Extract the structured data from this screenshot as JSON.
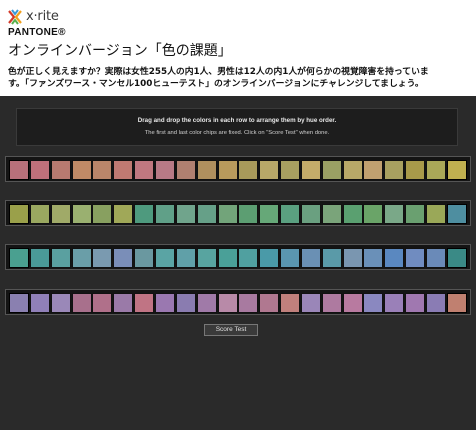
{
  "header": {
    "logo_text": "x·rite",
    "brand": "PANTONE®",
    "title": "オンラインバージョン「色の課題」",
    "description_line1": "色が正しく見えますか？実際は女性255人の内1人、男性は12人の内1人が何らかの視覚障害を持っていま",
    "description_line2": "す。「ファンズワース・マンセル100ヒューテスト」のオンラインバージョンにチャレンジしてましょう。"
  },
  "instructions": {
    "line1": "Drag and drop the colors in each row to arrange them by hue order.",
    "line2": "The first and last color chips are fixed. Click on \"Score Test\" when done."
  },
  "rows": [
    {
      "name": "row-1",
      "chips": [
        "#b8707a",
        "#c0707a",
        "#b87a70",
        "#c08a66",
        "#ba866a",
        "#c07a72",
        "#c07880",
        "#b87a86",
        "#b08070",
        "#b0905e",
        "#b89a5c",
        "#a89a5a",
        "#b8a868",
        "#a8a060",
        "#c4ac6a",
        "#9aa064",
        "#b8a868",
        "#c0a070",
        "#a8a060",
        "#a89a4a",
        "#aaa858",
        "#c0b050"
      ]
    },
    {
      "name": "row-2",
      "chips": [
        "#9aa04a",
        "#9aa860",
        "#a0aa68",
        "#9ab070",
        "#88a060",
        "#a0a858",
        "#4e9a7e",
        "#60a088",
        "#70a48c",
        "#66a088",
        "#72a47a",
        "#5c9e72",
        "#66a878",
        "#5aa080",
        "#6aa080",
        "#7aa47a",
        "#5aa070",
        "#6aa468",
        "#7aa888",
        "#6aa070",
        "#9aa858",
        "#4e8ea0"
      ]
    },
    {
      "name": "row-3",
      "chips": [
        "#4aa090",
        "#4a9a98",
        "#5aa0a0",
        "#6a9ea8",
        "#7a9ab0",
        "#7a8eb8",
        "#6a98a0",
        "#5aa4a4",
        "#60a0a8",
        "#58a4a0",
        "#4aa098",
        "#50a0a0",
        "#4a9aa8",
        "#5a96b0",
        "#6a90b4",
        "#5a9aa8",
        "#7a96b0",
        "#6a90b8",
        "#5a88c0",
        "#708cc0",
        "#6a8ab8",
        "#3a8a86"
      ]
    },
    {
      "name": "row-4",
      "chips": [
        "#8a80b0",
        "#9080b8",
        "#9a88b8",
        "#a8708c",
        "#b0708a",
        "#9a7aa8",
        "#c07484",
        "#9a78b0",
        "#8a7cb0",
        "#a07aa8",
        "#b88aa8",
        "#a87aa0",
        "#b07890",
        "#c0807c",
        "#9a86b8",
        "#ae7aa0",
        "#b87aa0",
        "#8a88c0",
        "#9a80b8",
        "#a078b0",
        "#8a7cb4",
        "#c08070"
      ]
    }
  ],
  "score_button": "Score Test"
}
